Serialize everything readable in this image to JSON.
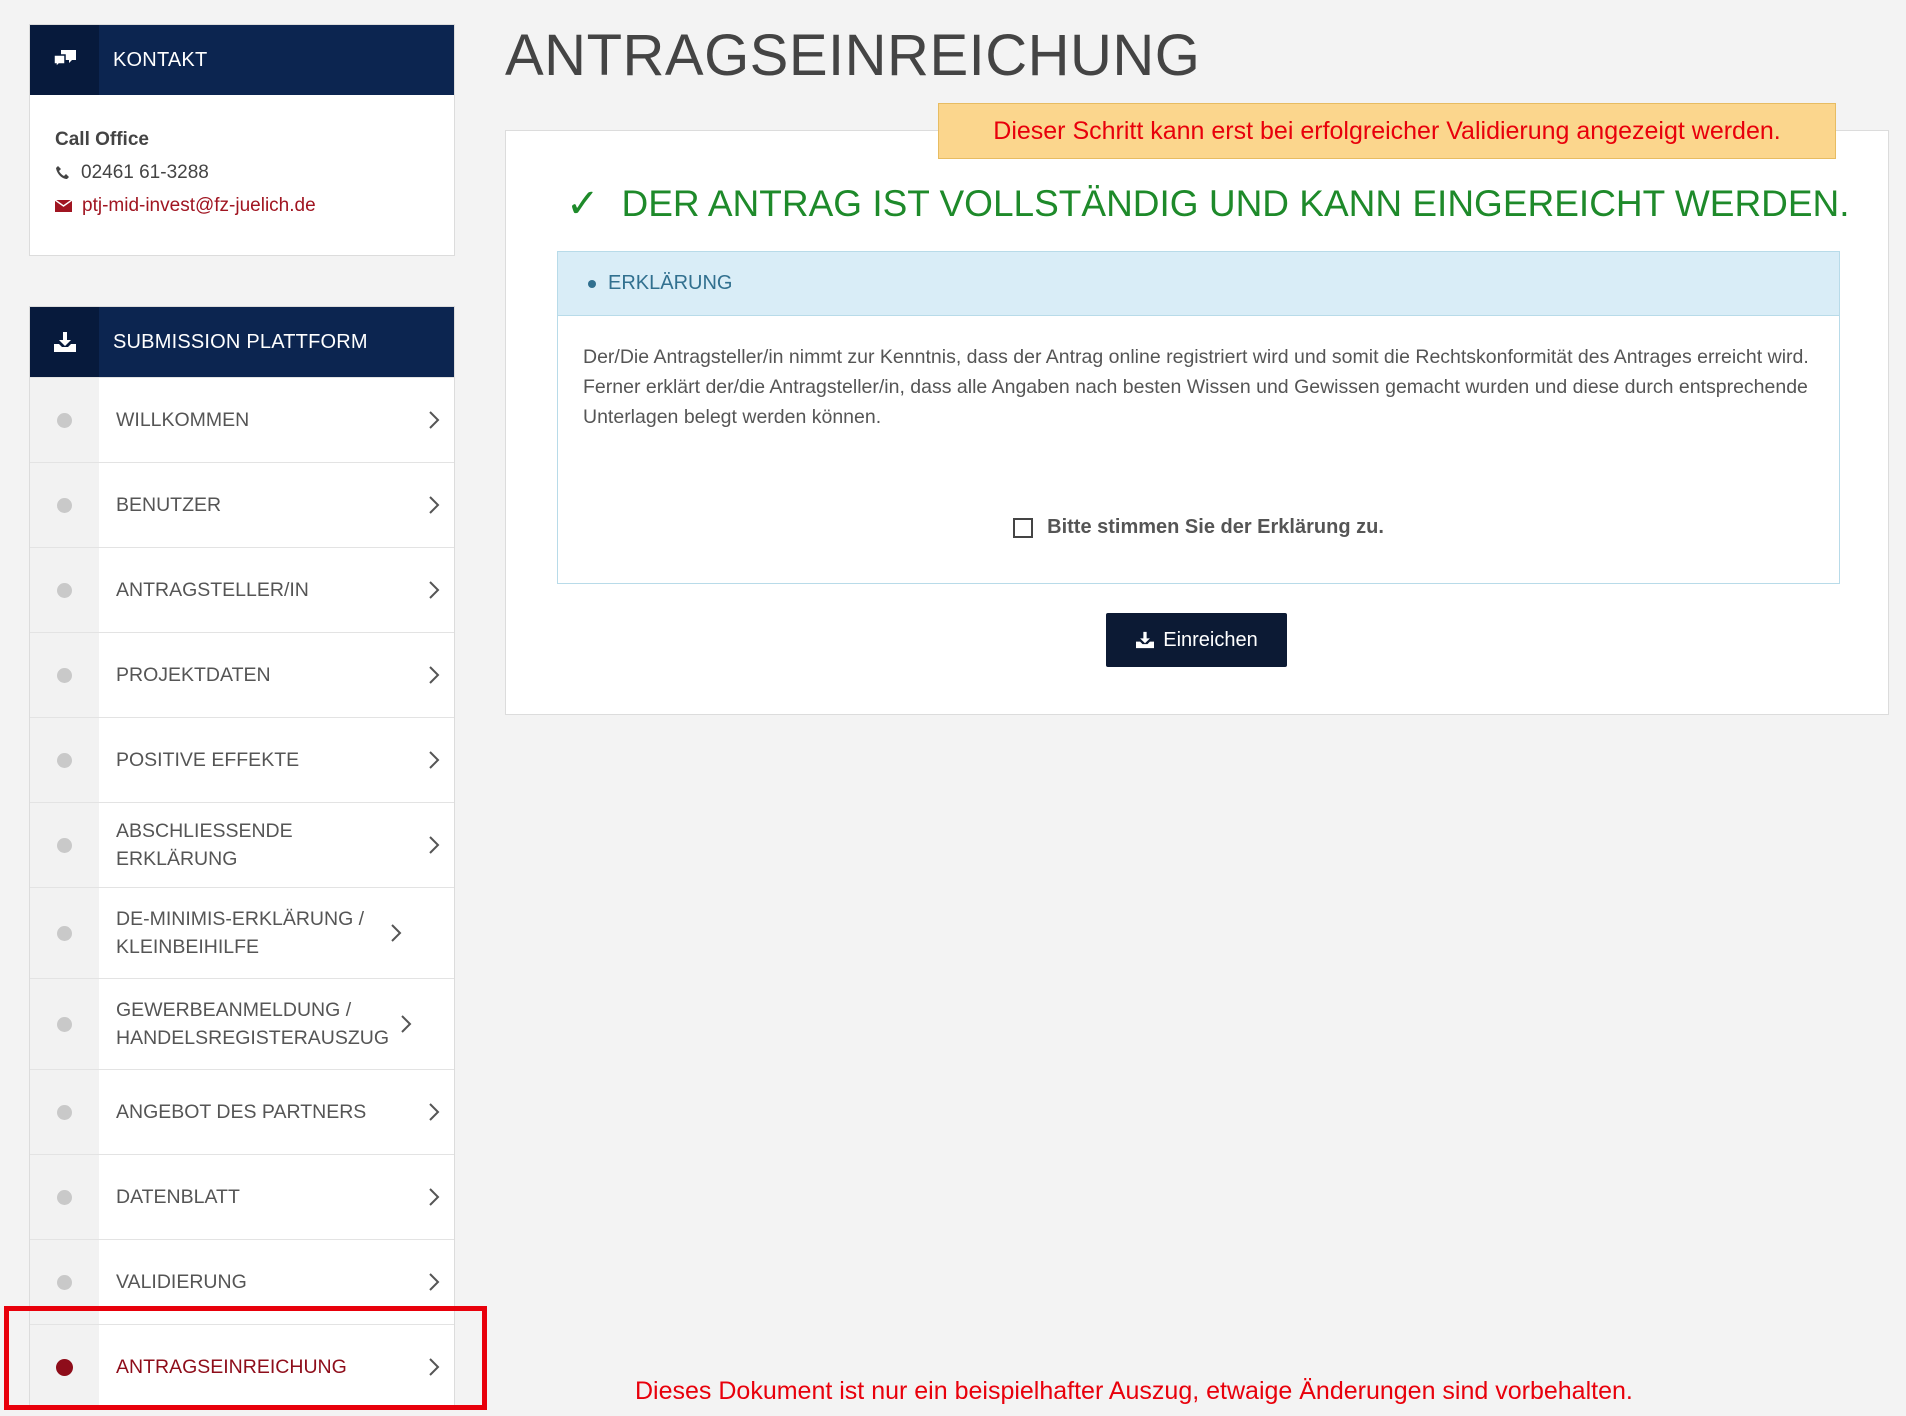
{
  "contact": {
    "header": "KONTAKT",
    "header_icon": "chat-bubbles-icon",
    "office_title": "Call Office",
    "phone": "02461 61-3288",
    "email": "ptj-mid-invest@fz-juelich.de"
  },
  "sidebar": {
    "header": "SUBMISSION PLATTFORM",
    "header_icon": "download-tray-icon",
    "items": [
      {
        "label": "WILLKOMMEN",
        "active": false
      },
      {
        "label": "BENUTZER",
        "active": false
      },
      {
        "label": "ANTRAGSTELLER/IN",
        "active": false
      },
      {
        "label": "PROJEKTDATEN",
        "active": false
      },
      {
        "label": "POSITIVE EFFEKTE",
        "active": false
      },
      {
        "label": "ABSCHLIESSENDE ERKLÄRUNG",
        "active": false
      },
      {
        "label": "DE-MINIMIS-ERKLÄRUNG / KLEINBEIHILFE",
        "active": false
      },
      {
        "label": "GEWERBEANMELDUNG / HANDELSREGISTERAUSZUG",
        "active": false
      },
      {
        "label": "ANGEBOT DES PARTNERS",
        "active": false
      },
      {
        "label": "DATENBLATT",
        "active": false
      },
      {
        "label": "VALIDIERUNG",
        "active": false
      },
      {
        "label": "ANTRAGSEINREICHUNG",
        "active": true
      }
    ]
  },
  "main": {
    "title": "ANTRAGSEINREICHUNG",
    "warning": "Dieser Schritt kann erst bei erfolgreicher Validierung angezeigt werden.",
    "success_message": "DER ANTRAG IST VOLLSTÄNDIG UND KANN EINGEREICHT WERDEN.",
    "declaration": {
      "heading": "ERKLÄRUNG",
      "paragraph1": "Der/Die Antragsteller/in nimmt zur Kenntnis, dass der Antrag online registriert wird und somit die Rechtskonformität des Antrages erreicht wird.",
      "paragraph2": "Ferner erklärt der/die Antragsteller/in, dass alle Angaben nach besten Wissen und Gewissen gemacht wurden und diese durch entsprechende Unterlagen belegt werden können.",
      "agree_label": "Bitte stimmen Sie der Erklärung zu.",
      "agree_checked": false
    },
    "submit_label": "Einreichen"
  },
  "footer_note": "Dieses Dokument ist nur ein beispielhafter Auszug, etwaige Änderungen sind vorbehalten.",
  "colors": {
    "nav_dark": "#0c2550",
    "active_red": "#8e0d1a",
    "success_green": "#1e8a2a",
    "warning_bg": "#fbd68d",
    "annotation_red": "#e8000b"
  }
}
